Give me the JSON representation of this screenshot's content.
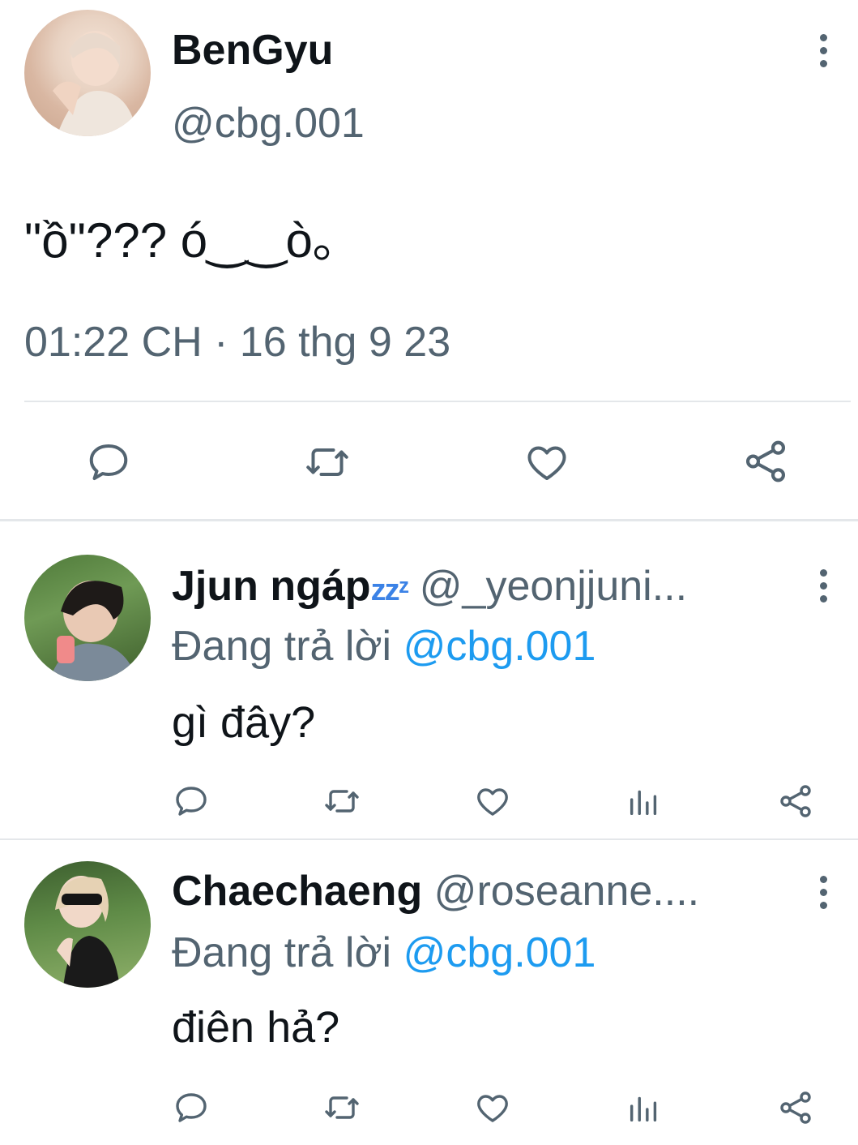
{
  "main_tweet": {
    "display_name": "BenGyu",
    "handle": "@cbg.001",
    "text": "\"ồ\"??? ó‿‿ò｡",
    "timestamp": "01:22 CH · 16 thg 9 23",
    "actions": [
      "reply-icon",
      "retweet-icon",
      "like-icon",
      "share-icon"
    ]
  },
  "replies": [
    {
      "display_name": "Jjun ngáp",
      "name_suffix": "zzᶻ",
      "handle": "@_yeonjjuni...",
      "replying_prefix": "Đang trả lời",
      "replying_to": "@cbg.001",
      "text": "gì đây?"
    },
    {
      "display_name": "Chaechaeng",
      "handle": "@roseanne....",
      "replying_prefix": "Đang trả lời",
      "replying_to": "@cbg.001",
      "text": "điên hả?"
    }
  ],
  "colors": {
    "text": "#0f1419",
    "muted": "#536471",
    "link": "#1d9bf0",
    "divider": "#e4e7ea",
    "icon": "#536471"
  }
}
